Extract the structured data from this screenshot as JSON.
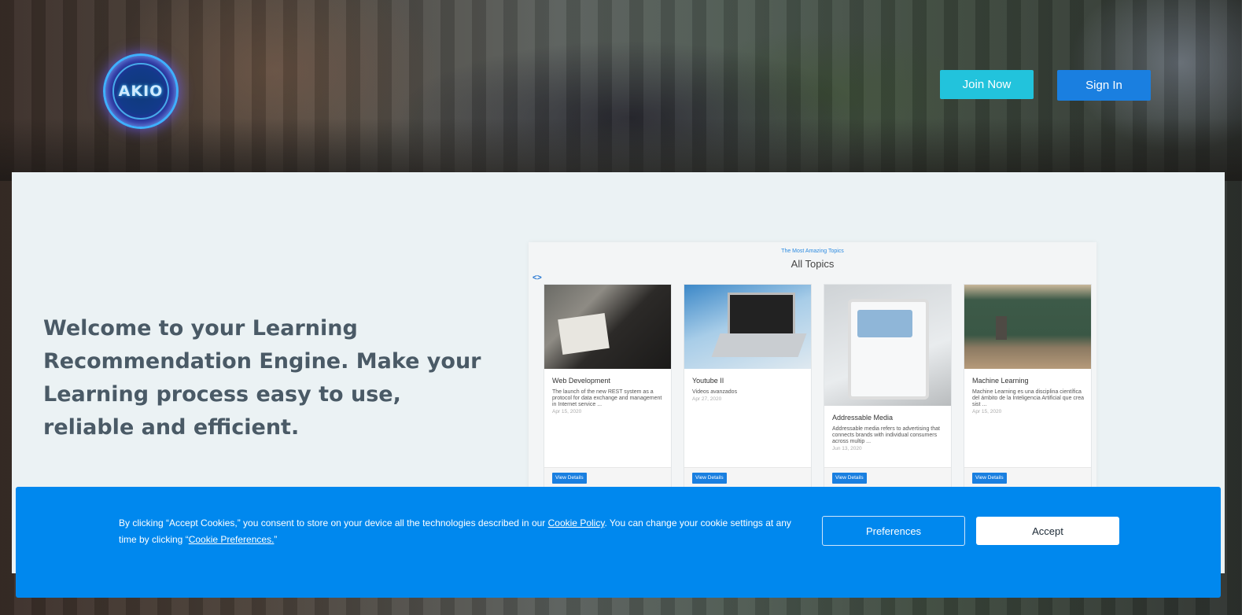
{
  "header": {
    "logo_text": "AKIO",
    "join_label": "Join Now",
    "signin_label": "Sign In"
  },
  "main": {
    "welcome": "Welcome to your Learning Recommendation Engine. Make your Learning process easy to use, reliable and efficient."
  },
  "topics": {
    "kicker": "The Most Amazing Topics",
    "title": "All Topics",
    "arrows": "<>",
    "cards": [
      {
        "name": "Web Development",
        "desc": "The launch of the new REST system as a protocol for data exchange and management in Internet service ...",
        "date": "Apr 15, 2020",
        "button": "View Details"
      },
      {
        "name": "Youtube II",
        "desc": "Videos avanzados",
        "date": "Apr 27, 2020",
        "button": "View Details"
      },
      {
        "name": "Addressable Media",
        "desc": "Addressable media refers to advertising that connects brands with individual consumers across multip ...",
        "date": "Jun 13, 2020",
        "button": "View Details"
      },
      {
        "name": "Machine Learning",
        "desc": "Machine Learning es una disciplina científica del ámbito de la Inteligencia Artificial que crea sist ...",
        "date": "Apr 15, 2020",
        "button": "View Details"
      }
    ]
  },
  "cookie": {
    "text_1": "By clicking “Accept Cookies,” you consent to store on your device all the technologies described in our ",
    "policy_link": "Cookie Policy",
    "text_2": ". You can change your cookie settings at any time by clicking “",
    "prefs_link": "Cookie Preferences.",
    "text_3": "”",
    "preferences_label": "Preferences",
    "accept_label": "Accept"
  }
}
